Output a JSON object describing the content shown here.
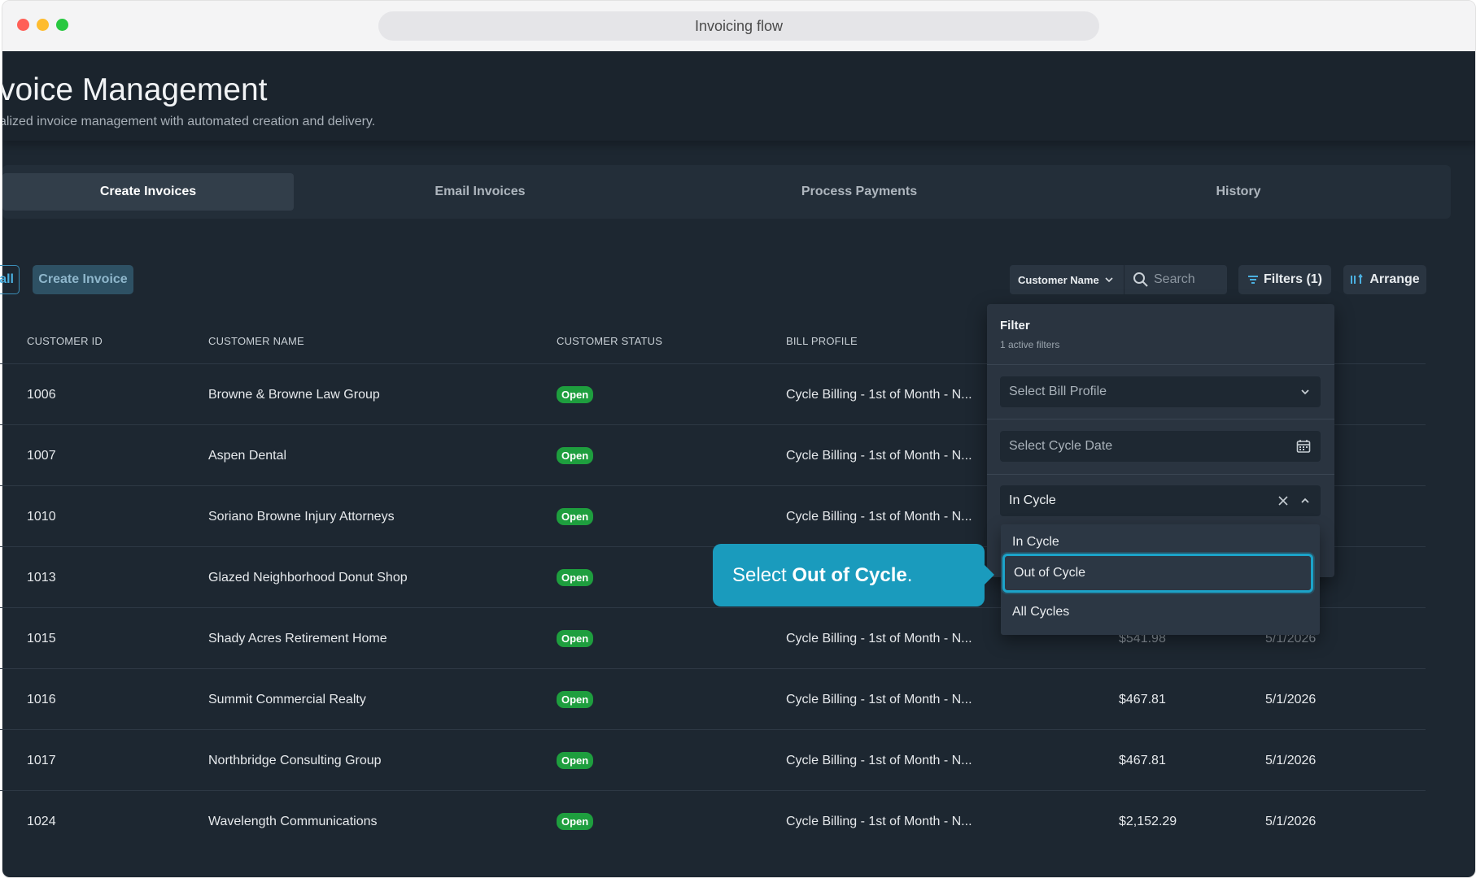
{
  "window": {
    "url_title": "Invoicing flow"
  },
  "header": {
    "title": "voice Management",
    "subtitle": "alized invoice management with automated creation and delivery."
  },
  "tabs": [
    {
      "label": "Create Invoices",
      "active": true
    },
    {
      "label": "Email Invoices",
      "active": false
    },
    {
      "label": "Process Payments",
      "active": false
    },
    {
      "label": "History",
      "active": false
    }
  ],
  "toolbar": {
    "all_label": "all",
    "create_label": "Create Invoice",
    "search_field_select": "Customer Name",
    "search_placeholder": "Search",
    "filters_label": "Filters (1)",
    "arrange_label": "Arrange"
  },
  "table": {
    "columns": [
      "CUSTOMER ID",
      "CUSTOMER NAME",
      "CUSTOMER STATUS",
      "BILL PROFILE"
    ],
    "rows": [
      {
        "id": "1006",
        "name": "Browne & Browne Law Group",
        "status": "Open",
        "bill": "Cycle Billing - 1st of Month - N...",
        "amount": "",
        "date": ""
      },
      {
        "id": "1007",
        "name": "Aspen Dental",
        "status": "Open",
        "bill": "Cycle Billing - 1st of Month - N...",
        "amount": "",
        "date": ""
      },
      {
        "id": "1010",
        "name": "Soriano Browne Injury Attorneys",
        "status": "Open",
        "bill": "Cycle Billing - 1st of Month - N...",
        "amount": "",
        "date": ""
      },
      {
        "id": "1013",
        "name": "Glazed Neighborhood Donut Shop",
        "status": "Open",
        "bill": "",
        "amount": "",
        "date": ""
      },
      {
        "id": "1015",
        "name": "Shady Acres Retirement Home",
        "status": "Open",
        "bill": "Cycle Billing - 1st of Month - N...",
        "amount": "$541.98",
        "date": "5/1/2026"
      },
      {
        "id": "1016",
        "name": "Summit Commercial Realty",
        "status": "Open",
        "bill": "Cycle Billing - 1st of Month - N...",
        "amount": "$467.81",
        "date": "5/1/2026"
      },
      {
        "id": "1017",
        "name": "Northbridge Consulting Group",
        "status": "Open",
        "bill": "Cycle Billing - 1st of Month - N...",
        "amount": "$467.81",
        "date": "5/1/2026"
      },
      {
        "id": "1024",
        "name": "Wavelength Communications",
        "status": "Open",
        "bill": "Cycle Billing - 1st of Month - N...",
        "amount": "$2,152.29",
        "date": "5/1/2026"
      }
    ]
  },
  "filter_panel": {
    "title": "Filter",
    "subtitle": "1 active filters",
    "bill_profile_placeholder": "Select Bill Profile",
    "cycle_date_placeholder": "Select Cycle Date",
    "cycle_value": "In Cycle",
    "options": [
      "In Cycle",
      "Out of Cycle",
      "All Cycles"
    ],
    "highlighted_option": "Out of Cycle"
  },
  "tooltip": {
    "prefix": "Select ",
    "bold": "Out of Cycle",
    "suffix": "."
  },
  "colors": {
    "accent": "#1a9bbd",
    "badge_open": "#1e9e3e",
    "background": "#1d2731"
  }
}
